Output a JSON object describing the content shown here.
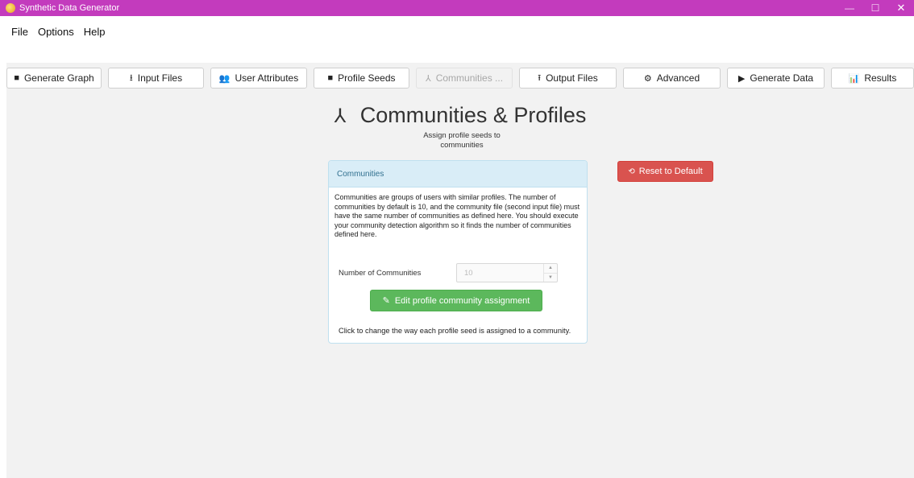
{
  "window": {
    "title": "Synthetic Data Generator",
    "controls": {
      "minimize": "—",
      "maximize": "☐",
      "close": "✕"
    }
  },
  "menu": {
    "items": [
      "File",
      "Options",
      "Help"
    ]
  },
  "tabs": [
    {
      "label": "Generate Graph",
      "icon": "grid-icon",
      "glyph": "■",
      "disabled": false
    },
    {
      "label": "Input Files",
      "icon": "download-icon",
      "glyph": "⭳",
      "disabled": false
    },
    {
      "label": "User Attributes",
      "icon": "users-icon",
      "glyph": "👥",
      "disabled": false
    },
    {
      "label": "Profile Seeds",
      "icon": "grid-icon",
      "glyph": "■",
      "disabled": false
    },
    {
      "label": "Communities ...",
      "icon": "network-icon",
      "glyph": "⅄",
      "disabled": true
    },
    {
      "label": "Output Files",
      "icon": "upload-icon",
      "glyph": "⭱",
      "disabled": false
    },
    {
      "label": "Advanced",
      "icon": "gear-icon",
      "glyph": "⚙",
      "disabled": false
    },
    {
      "label": "Generate Data",
      "icon": "play-icon",
      "glyph": "▶",
      "disabled": false
    },
    {
      "label": "Results",
      "icon": "bar-chart-icon",
      "glyph": "📊",
      "disabled": false
    }
  ],
  "page": {
    "title": "Communities & Profiles",
    "title_glyph": "⅄",
    "subtitle": "Assign profile seeds to communities"
  },
  "panel": {
    "header": "Communities",
    "description": "Communities are groups of users with similar profiles. The number of communities by default is 10, and the community file (second input file) must have the same number of communities as defined here. You should execute your community detection algorithm so it finds the number of communities defined here.",
    "field_label": "Number of Communities",
    "field_value": "10",
    "edit_button": "Edit profile community assignment",
    "help_text": "Click to change the way each profile seed is assigned to a community."
  },
  "reset_button": "Reset to Default",
  "colors": {
    "titlebar": "#c33bbd",
    "panel_header_bg": "#d9edf7",
    "success": "#5cb85c",
    "danger": "#d9534f"
  }
}
